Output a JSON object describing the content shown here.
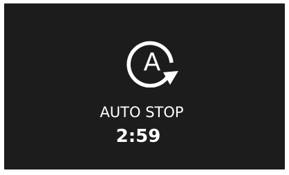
{
  "display": {
    "icon": "auto-stop-icon",
    "icon_letter": "A",
    "mode_label": "AUTO STOP",
    "timer": "2:59"
  },
  "colors": {
    "background": "#1c1c1c",
    "foreground": "#ffffff"
  }
}
